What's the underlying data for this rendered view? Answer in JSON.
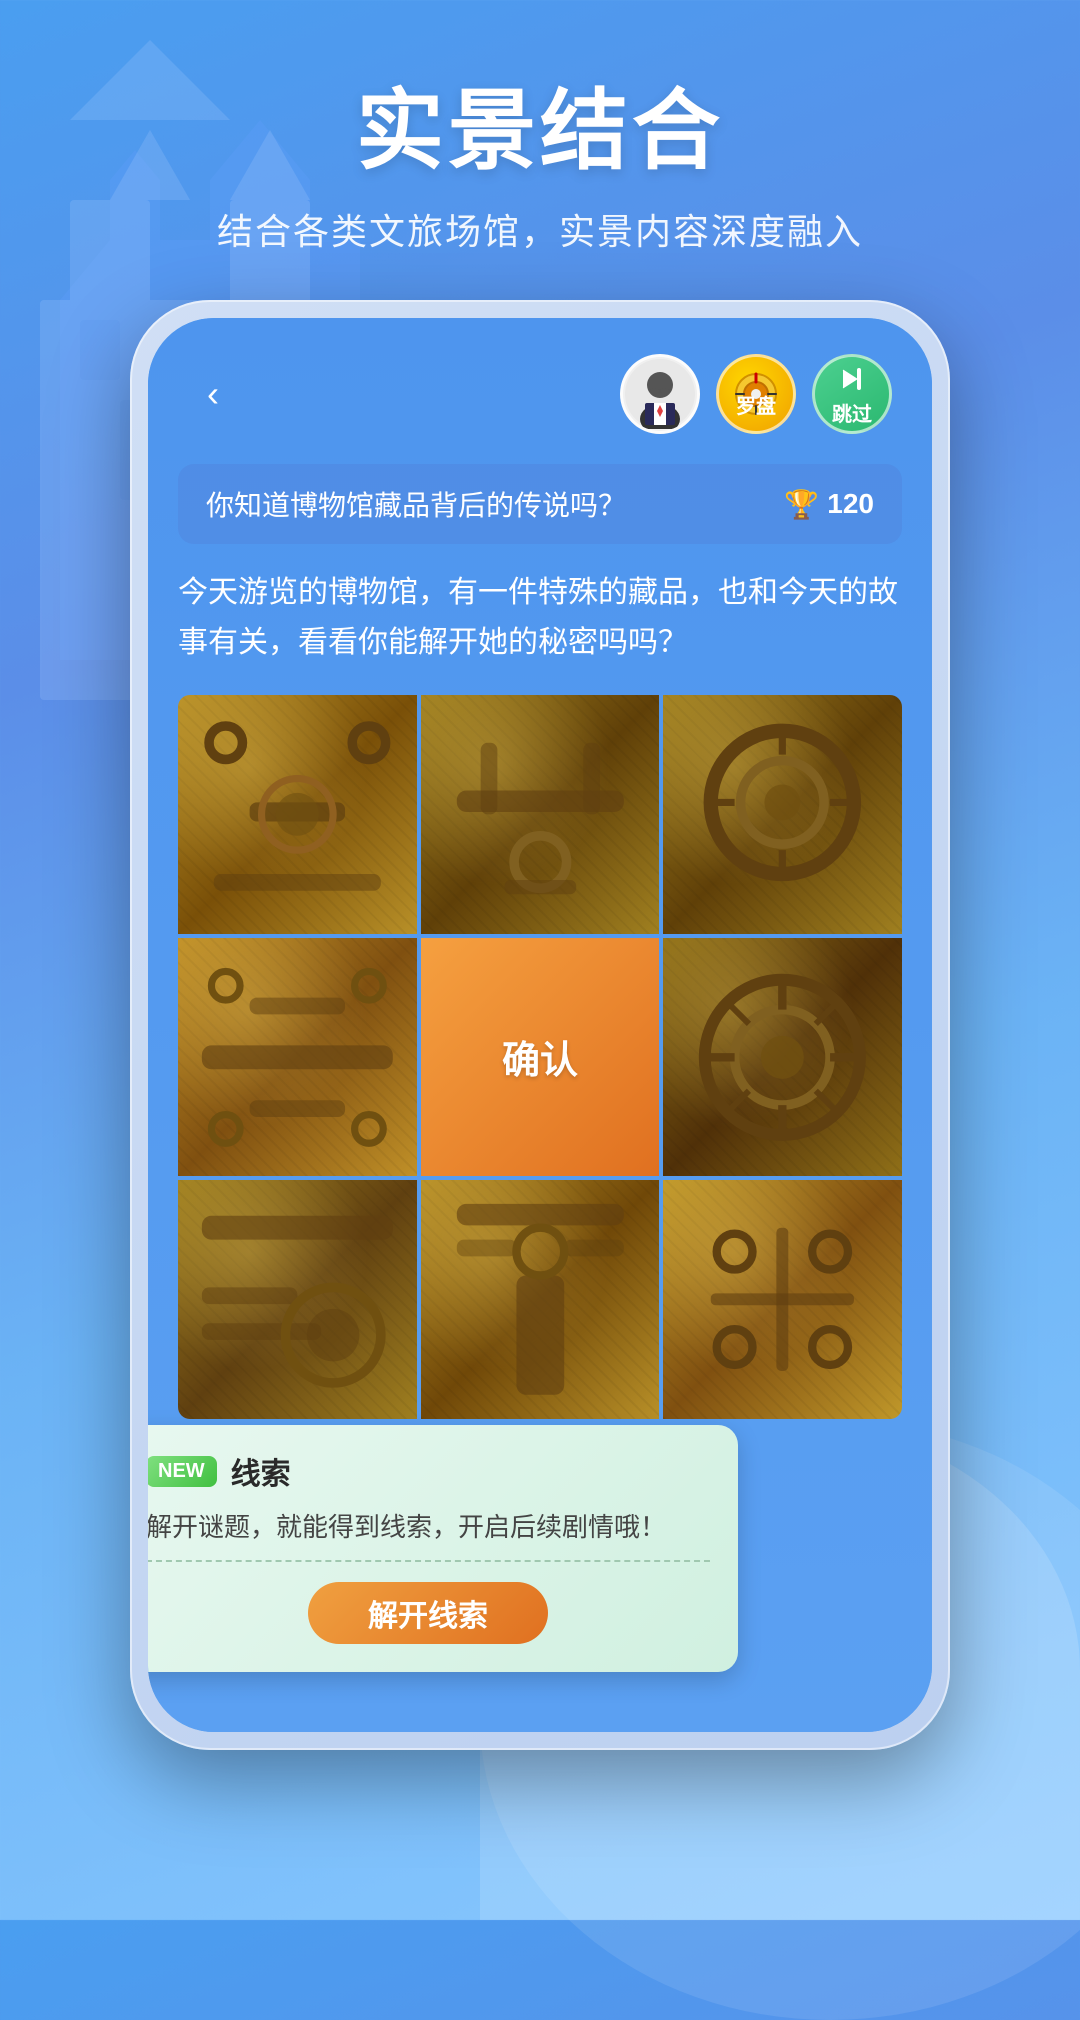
{
  "page": {
    "background_gradient_start": "#4a9ef0",
    "background_gradient_end": "#89c8ff"
  },
  "header": {
    "main_title": "实景结合",
    "sub_title": "结合各类文旅场馆，实景内容深度融入"
  },
  "phone": {
    "nav": {
      "back_label": "‹",
      "luopan_label": "罗盘",
      "skip_label": "跳过"
    },
    "question": {
      "text": "你知道博物馆藏品背后的传说吗？",
      "score": "120",
      "trophy_icon": "🏆"
    },
    "description": "今天游览的博物馆，有一件特殊的藏品，也和今天的故事有关，看看你能解开她的秘密吗吗？",
    "puzzle": {
      "confirm_label": "确认"
    },
    "clue": {
      "new_label": "NEW",
      "title": "线索",
      "description": "解开谜题，就能得到线索，开启后续剧情哦！",
      "unlock_label": "解开线索"
    }
  }
}
